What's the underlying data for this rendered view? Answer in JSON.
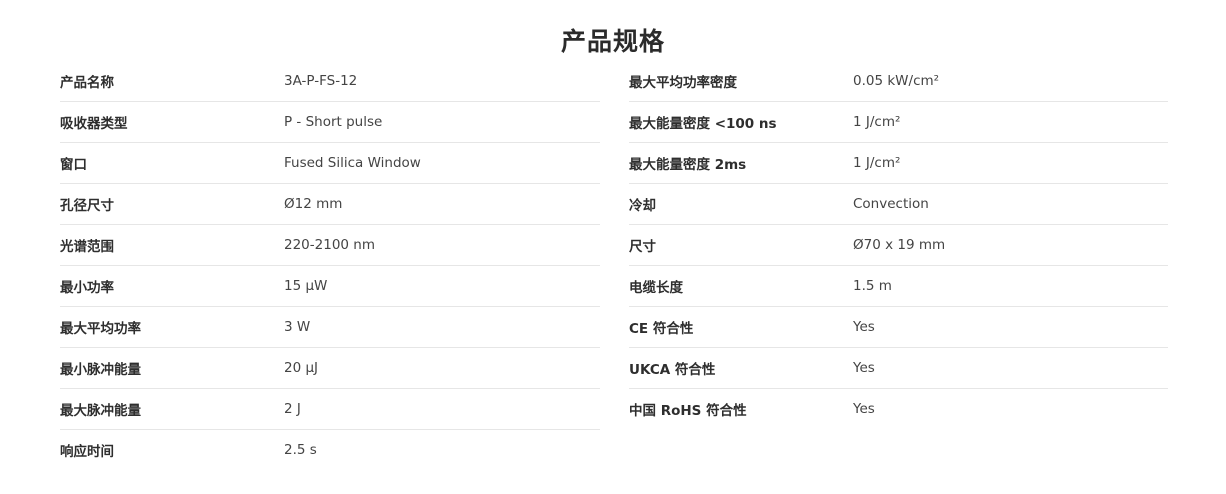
{
  "title": "产品规格",
  "left_rows": [
    {
      "label": "产品名称",
      "value": "3A-P-FS-12"
    },
    {
      "label": "吸收器类型",
      "value": "P - Short pulse"
    },
    {
      "label": "窗口",
      "value": "Fused Silica Window"
    },
    {
      "label": "孔径尺寸",
      "value": "Ø12 mm"
    },
    {
      "label": "光谱范围",
      "value": "220-2100 nm"
    },
    {
      "label": "最小功率",
      "value": "15 µW"
    },
    {
      "label": "最大平均功率",
      "value": "3 W"
    },
    {
      "label": "最小脉冲能量",
      "value": "20 µJ"
    },
    {
      "label": "最大脉冲能量",
      "value": "2 J"
    },
    {
      "label": "响应时间",
      "value": "2.5 s"
    }
  ],
  "right_rows": [
    {
      "label": "最大平均功率密度",
      "value": "0.05 kW/cm²"
    },
    {
      "label": "最大能量密度 <100 ns",
      "value": "1 J/cm²"
    },
    {
      "label": "最大能量密度 2ms",
      "value": "1 J/cm²"
    },
    {
      "label": "冷却",
      "value": "Convection"
    },
    {
      "label": "尺寸",
      "value": "Ø70 x 19 mm"
    },
    {
      "label": "电缆长度",
      "value": "1.5 m"
    },
    {
      "label": "CE 符合性",
      "value": "Yes"
    },
    {
      "label": "UKCA 符合性",
      "value": "Yes"
    },
    {
      "label": "中国 RoHS 符合性",
      "value": "Yes"
    }
  ]
}
